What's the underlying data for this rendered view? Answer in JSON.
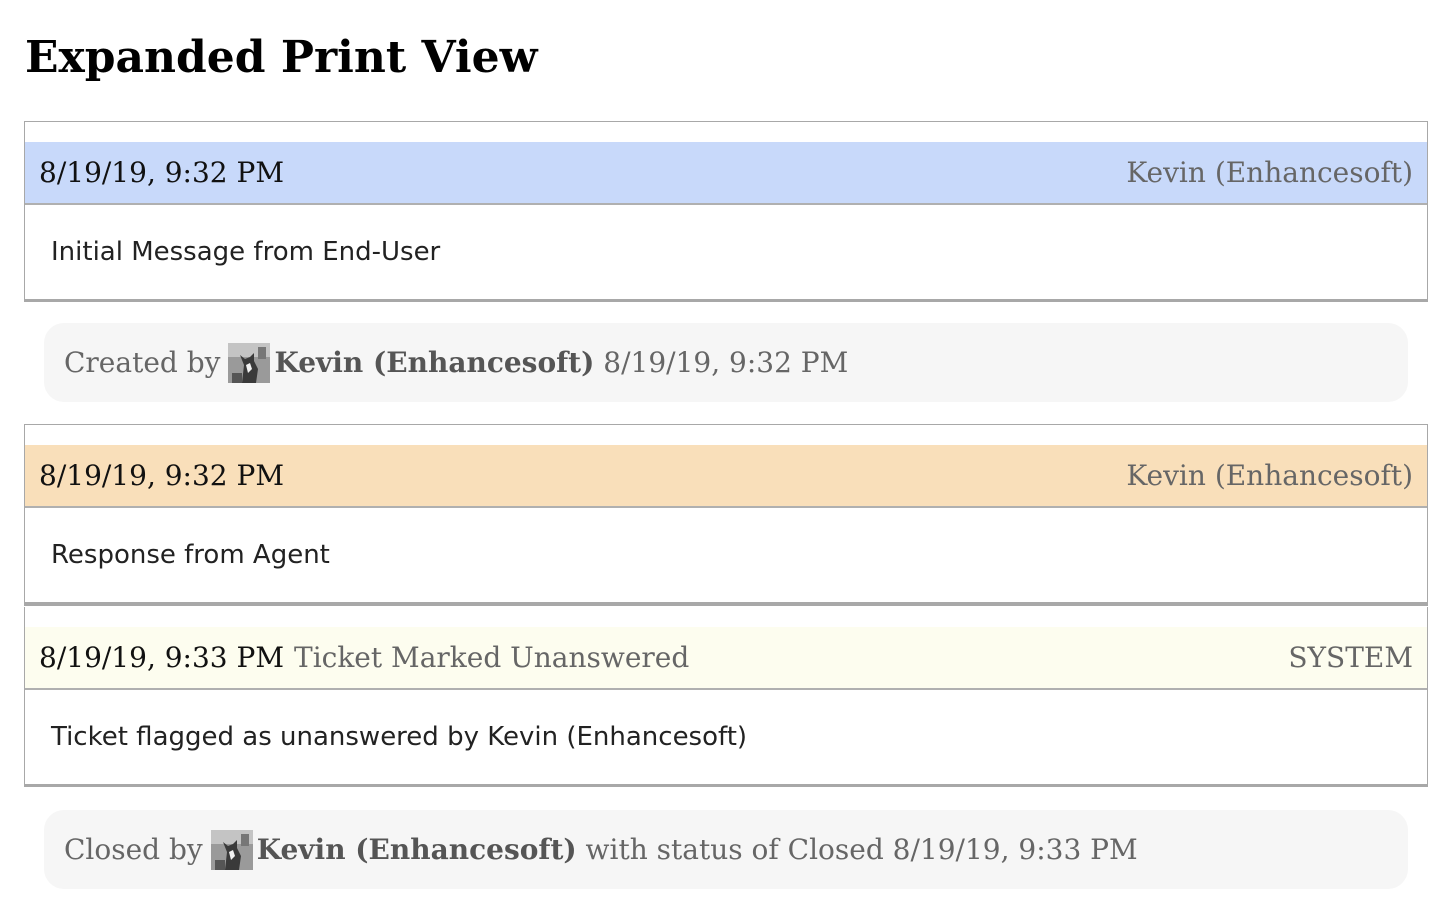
{
  "page": {
    "title": "Expanded Print View"
  },
  "messages": [
    {
      "date": "8/19/19, 9:32 PM",
      "subject": "",
      "author": "Kevin (Enhancesoft)",
      "body": "Initial Message from End-User",
      "header_color": "#c8d9fa"
    },
    {
      "date": "8/19/19, 9:32 PM",
      "subject": "",
      "author": "Kevin (Enhancesoft)",
      "body": "Response from Agent",
      "header_color": "#f9dfba"
    },
    {
      "date": "8/19/19, 9:33 PM",
      "subject": "Ticket Marked Unanswered",
      "author": "SYSTEM",
      "body": "Ticket flagged as unanswered by Kevin (Enhancesoft)",
      "header_color": "#fdfdef"
    }
  ],
  "events": [
    {
      "prefix": "Created by",
      "avatar_icon": "user-avatar-icon",
      "user": "Kevin (Enhancesoft)",
      "suffix": "8/19/19, 9:32 PM"
    },
    {
      "prefix": "Closed by",
      "avatar_icon": "user-avatar-icon",
      "user": "Kevin (Enhancesoft)",
      "suffix": "with status of Closed 8/19/19, 9:33 PM"
    }
  ]
}
